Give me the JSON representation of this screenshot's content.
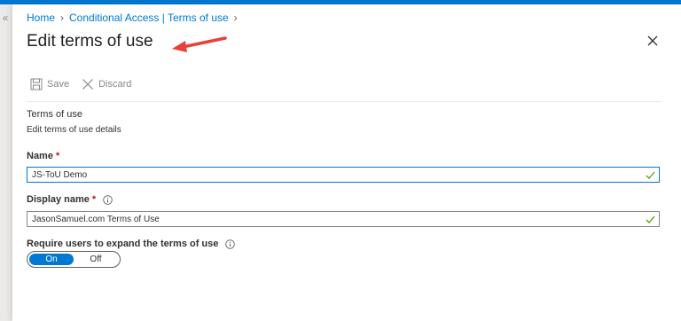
{
  "breadcrumb": {
    "items": [
      "Home",
      "Conditional Access | Terms of use"
    ]
  },
  "page": {
    "title": "Edit terms of use"
  },
  "toolbar": {
    "save_label": "Save",
    "discard_label": "Discard"
  },
  "section": {
    "title": "Terms of use",
    "subtitle": "Edit terms of use details"
  },
  "fields": {
    "name": {
      "label": "Name",
      "required": "*",
      "value": "JS-ToU Demo"
    },
    "display_name": {
      "label": "Display name",
      "required": "*",
      "value": "JasonSamuel.com Terms of Use"
    },
    "require_expand": {
      "label": "Require users to expand the terms of use"
    }
  },
  "toggle": {
    "on_label": "On",
    "off_label": "Off",
    "selected": "On"
  },
  "colors": {
    "accent": "#0078d4",
    "annotation": "#e8403a",
    "valid": "#57a300",
    "required": "#a4262c"
  },
  "icons": {
    "collapse": "«",
    "save": "save-icon",
    "discard": "close-icon",
    "info": "info-icon",
    "check": "checkmark-icon"
  }
}
